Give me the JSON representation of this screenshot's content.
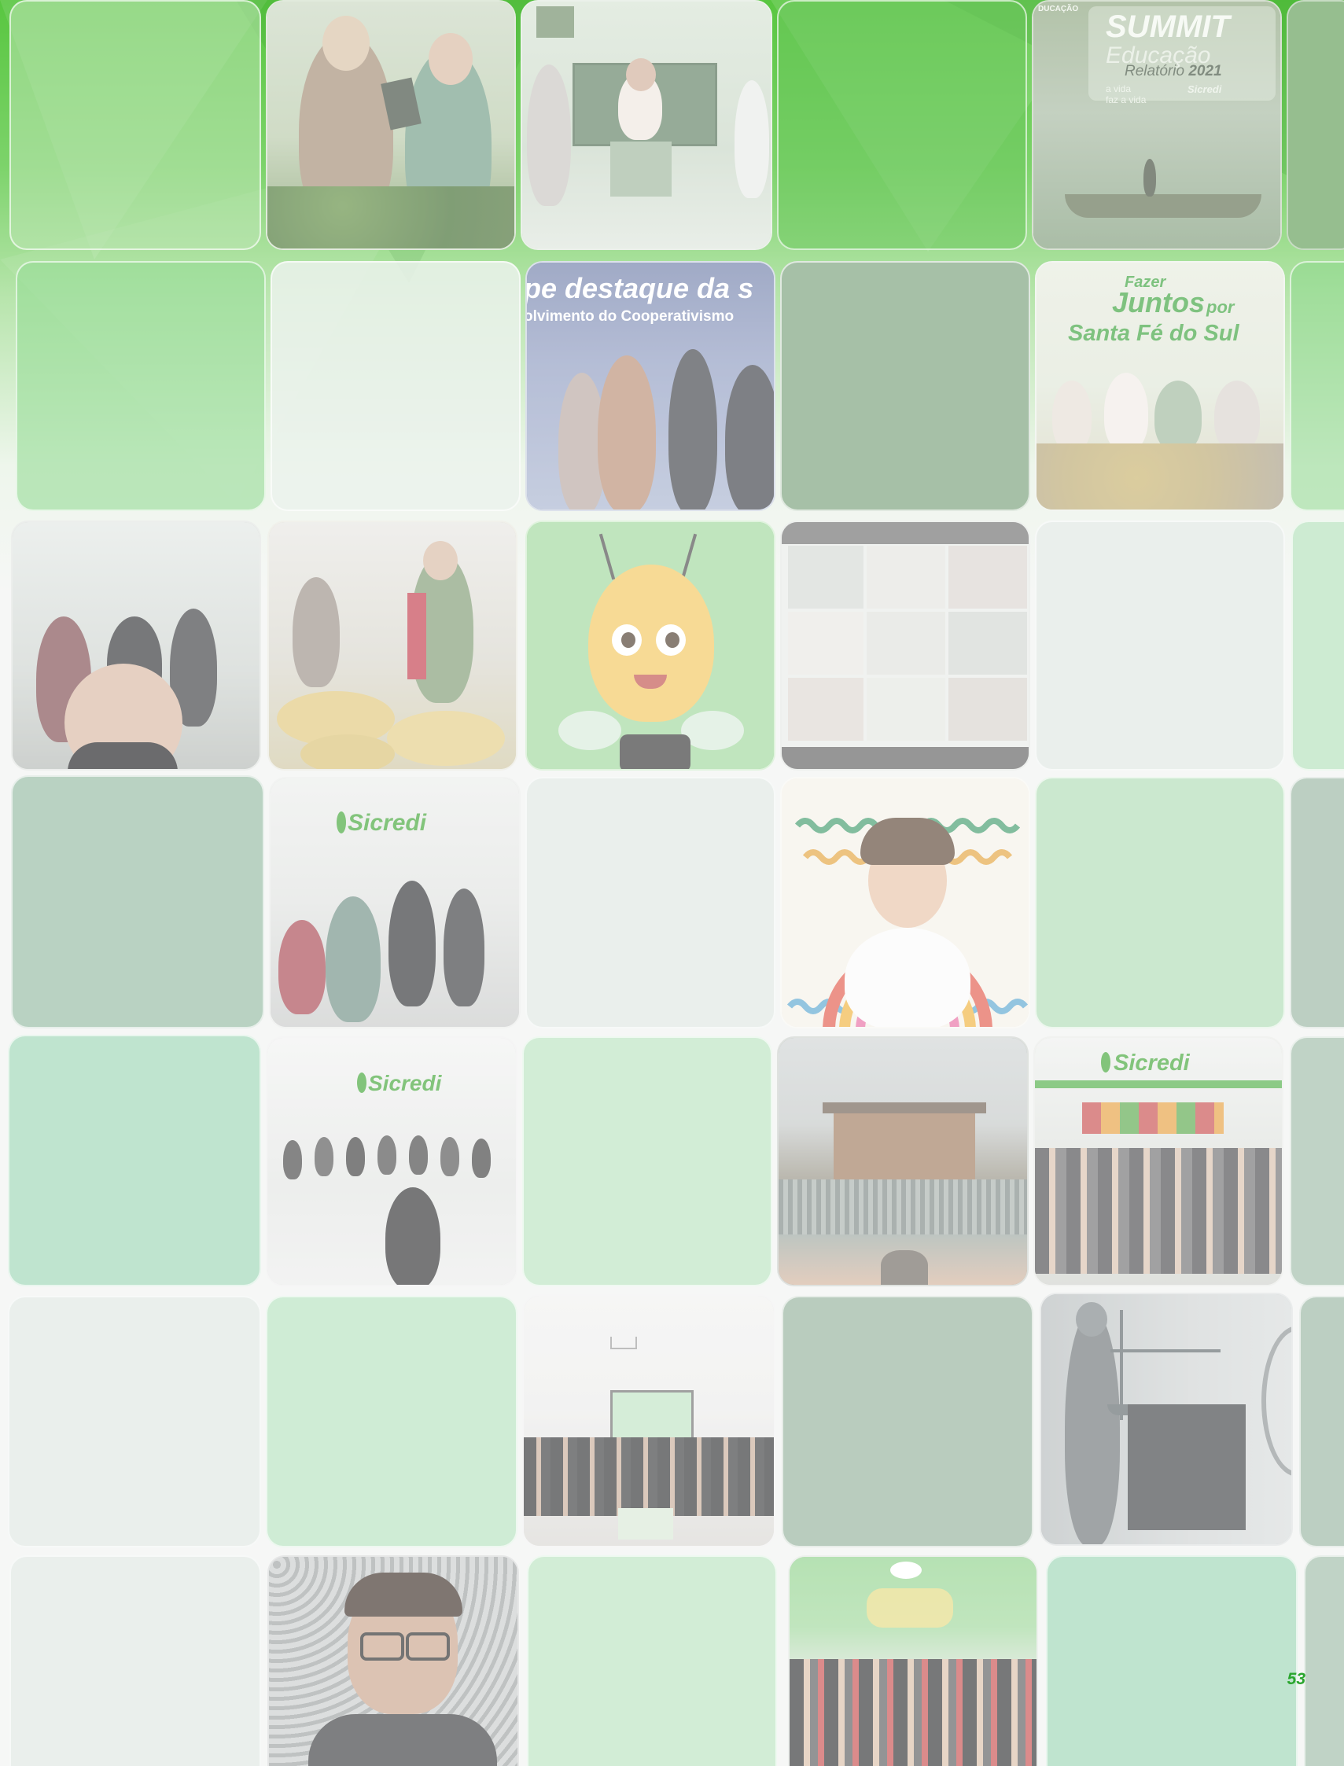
{
  "report": {
    "title_word": "Relatório",
    "year": "2021",
    "page_number": "53"
  },
  "tiles": {
    "summit": {
      "header": "DUCAÇÃO",
      "title": "SUMMIT",
      "subtitle": "Educação",
      "tagline_1": "a vida",
      "tagline_2": "faz a vida",
      "brand": "Sicredi"
    },
    "award": {
      "line1": "pe destaque da s",
      "line2": "olvimento do Cooperativismo"
    },
    "campaign": {
      "line1": "Fazer",
      "line2": "Juntos",
      "line3": "por",
      "line4": "Santa Fé do Sul"
    },
    "branch_sign_1": "Sicredi",
    "branch_sign_2": "Sicredi",
    "branch_sign_3": "Sicredi"
  },
  "colors": {
    "brand_green": "#3fa535",
    "page_number": "#2aa62e",
    "tile_mint": "#cde9d3",
    "tile_sage": "#b9d2c2",
    "tile_fog": "#e9eeeb",
    "tile_teal": "#bfe4cf"
  }
}
